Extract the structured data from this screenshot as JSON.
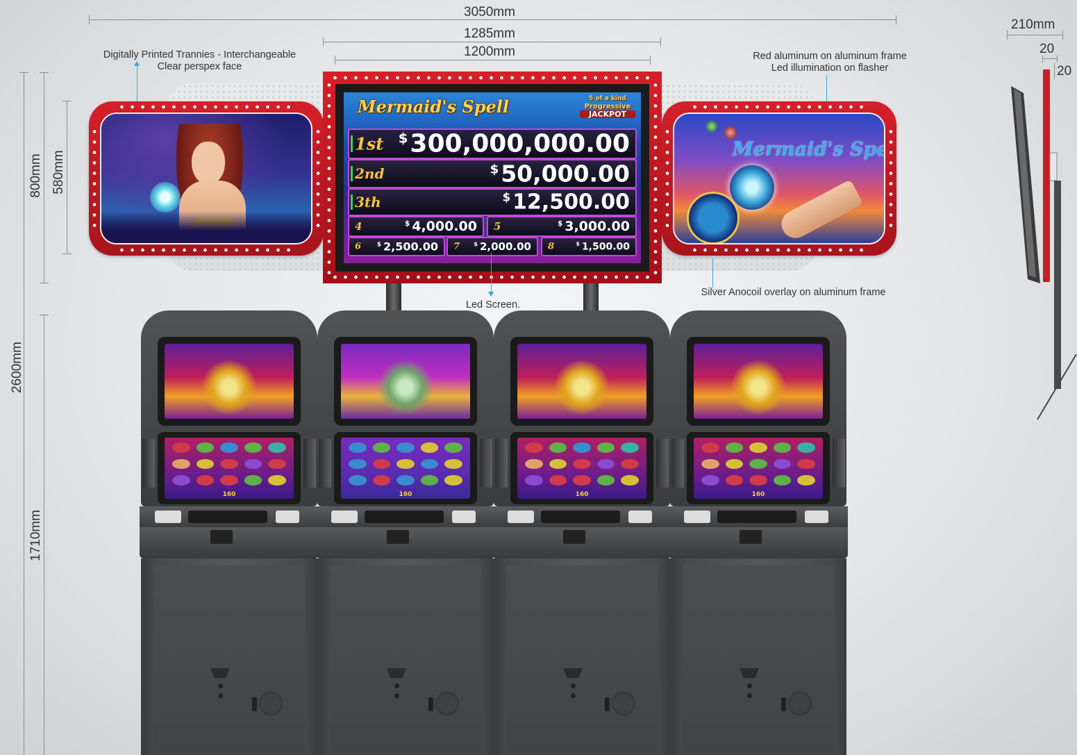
{
  "dimensions": {
    "total_width": "3050mm",
    "led_frame_width": "1285mm",
    "led_screen_width": "1200mm",
    "depth": "210mm",
    "frame_thickness_a": "20",
    "frame_thickness_b": "20",
    "sign_height": "800mm",
    "panel_height": "580mm",
    "total_height": "2600mm",
    "cabinet_height": "1710mm"
  },
  "notes": {
    "left_panel_line1": "Digitally Printed Trannies - Interchangeable",
    "left_panel_line2": "Clear perspex face",
    "right_panel_line1": "Red aluminum on aluminum frame",
    "right_panel_line2": "Led illumination on flasher",
    "led_screen": "Led Screen.",
    "overlay": "Silver Anocoil overlay on aluminum frame"
  },
  "led_display": {
    "logo": "Mermaid's Spell",
    "badge_line1": "5 of a kind",
    "badge_line2": "Progressive",
    "badge_line3": "JACKPOT",
    "levels": [
      {
        "label": "1st",
        "currency": "$",
        "amount": "300,000,000.00"
      },
      {
        "label": "2nd",
        "currency": "$",
        "amount": "50,000.00"
      },
      {
        "label": "3th",
        "currency": "$",
        "amount": "12,500.00"
      },
      {
        "label": "4",
        "currency": "$",
        "amount": "4,000.00"
      },
      {
        "label": "5",
        "currency": "$",
        "amount": "3,000.00"
      },
      {
        "label": "6",
        "currency": "$",
        "amount": "2,500.00"
      },
      {
        "label": "7",
        "currency": "$",
        "amount": "2,000.00"
      },
      {
        "label": "8",
        "currency": "$",
        "amount": "1,500.00"
      }
    ]
  },
  "right_panel_logo": "Mermaid's Spell",
  "cabinets": [
    {
      "credits": "160"
    },
    {
      "credits": "160"
    },
    {
      "credits": "160"
    },
    {
      "credits": "160"
    }
  ],
  "colors": {
    "frame_red": "#d4202a",
    "leader_blue": "#3aa7d8",
    "cabinet_grey": "#4a4c4e"
  }
}
